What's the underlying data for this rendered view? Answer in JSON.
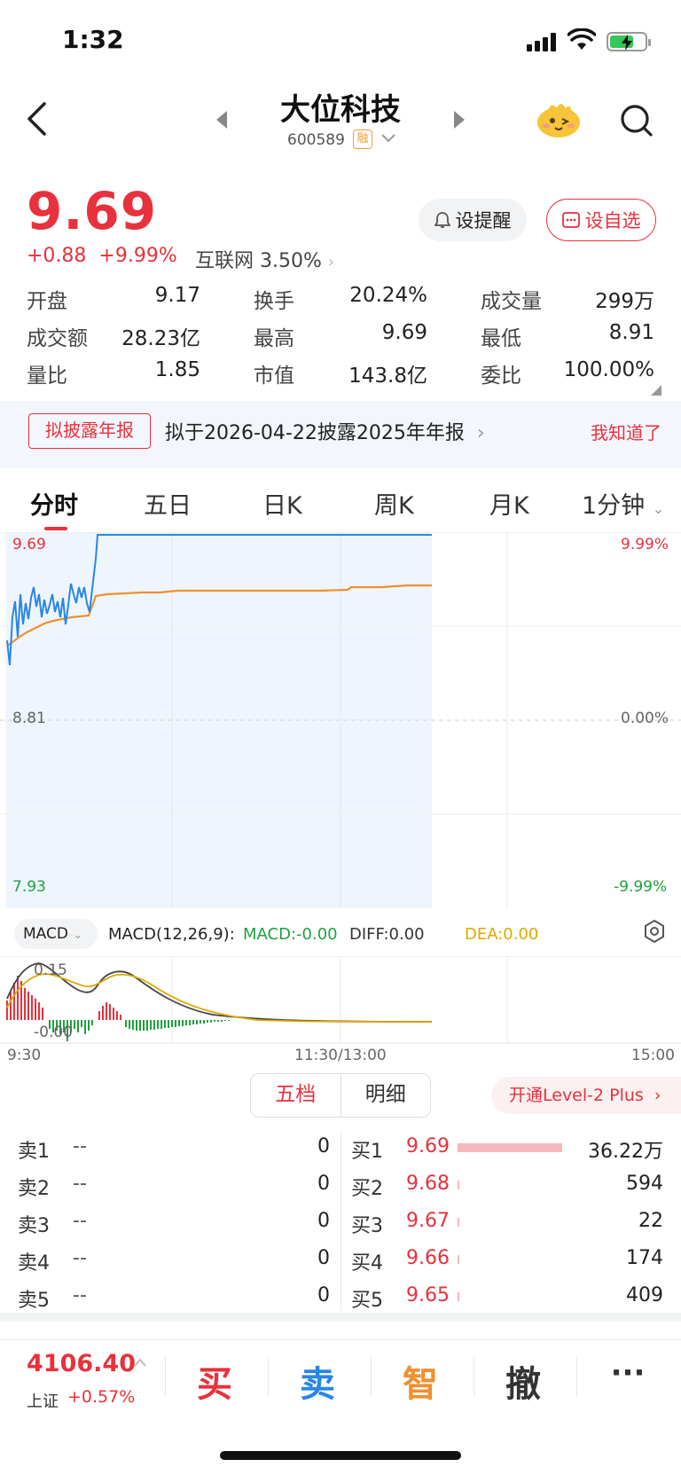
{
  "status_bar": {
    "time": "1:32"
  },
  "header": {
    "name": "大位科技",
    "code": "600589",
    "margin_badge": "融"
  },
  "quote": {
    "price": "9.69",
    "change": "+0.88",
    "change_pct": "+9.99%",
    "sector": "互联网 3.50%",
    "remind_label": "设提醒",
    "watch_label": "设自选",
    "stats": [
      {
        "label": "开盘",
        "value": "9.17",
        "color": "#e8313c"
      },
      {
        "label": "换手",
        "value": "20.24%",
        "color": "#222222"
      },
      {
        "label": "成交量",
        "value": "299万",
        "color": "#222222"
      },
      {
        "label": "成交额",
        "value": "28.23亿",
        "color": "#222222"
      },
      {
        "label": "最高",
        "value": "9.69",
        "color": "#e8313c"
      },
      {
        "label": "最低",
        "value": "8.91",
        "color": "#e8313c"
      },
      {
        "label": "量比",
        "value": "1.85",
        "color": "#222222"
      },
      {
        "label": "市值",
        "value": "143.8亿",
        "color": "#222222"
      },
      {
        "label": "委比",
        "value": "100.00%",
        "color": "#e8313c"
      }
    ]
  },
  "banner": {
    "tag": "拟披露年报",
    "text": "拟于2026-04-22披露2025年年报",
    "dismiss": "我知道了"
  },
  "tabs": [
    "分时",
    "五日",
    "日K",
    "周K",
    "月K",
    "1分钟"
  ],
  "intraday": {
    "y_top": "9.69",
    "y_mid": "8.81",
    "y_bottom": "7.93",
    "pct_top": "9.99%",
    "pct_mid": "0.00%",
    "pct_bottom": "-9.99%"
  },
  "macd": {
    "selector": "MACD",
    "params": "MACD(12,26,9):",
    "macd": "MACD:-0.00",
    "diff": "DIFF:0.00",
    "dea": "DEA:0.00",
    "y_high": "0.15",
    "y_low": "-0.00"
  },
  "time_axis": [
    "9:30",
    "11:30/13:00",
    "15:00"
  ],
  "order_book": {
    "tab_five": "五档",
    "tab_detail": "明细",
    "level2": "开通Level-2 Plus",
    "sells": [
      {
        "name": "卖1",
        "price": "--",
        "vol": "0"
      },
      {
        "name": "卖2",
        "price": "--",
        "vol": "0"
      },
      {
        "name": "卖3",
        "price": "--",
        "vol": "0"
      },
      {
        "name": "卖4",
        "price": "--",
        "vol": "0"
      },
      {
        "name": "卖5",
        "price": "--",
        "vol": "0"
      }
    ],
    "buys": [
      {
        "name": "买1",
        "price": "9.69",
        "vol": "36.22万",
        "ratio": 1.0
      },
      {
        "name": "买2",
        "price": "9.68",
        "vol": "594",
        "ratio": 0.02
      },
      {
        "name": "买3",
        "price": "9.67",
        "vol": "22",
        "ratio": 0.01
      },
      {
        "name": "买4",
        "price": "9.66",
        "vol": "174",
        "ratio": 0.01
      },
      {
        "name": "买5",
        "price": "9.65",
        "vol": "409",
        "ratio": 0.01
      }
    ]
  },
  "bottom_bar": {
    "index_value": "4106.40",
    "index_name": "上证",
    "index_change": "+0.57%",
    "buy": "买",
    "sell": "卖",
    "smart": "智",
    "cancel": "撤",
    "more": "···"
  }
}
